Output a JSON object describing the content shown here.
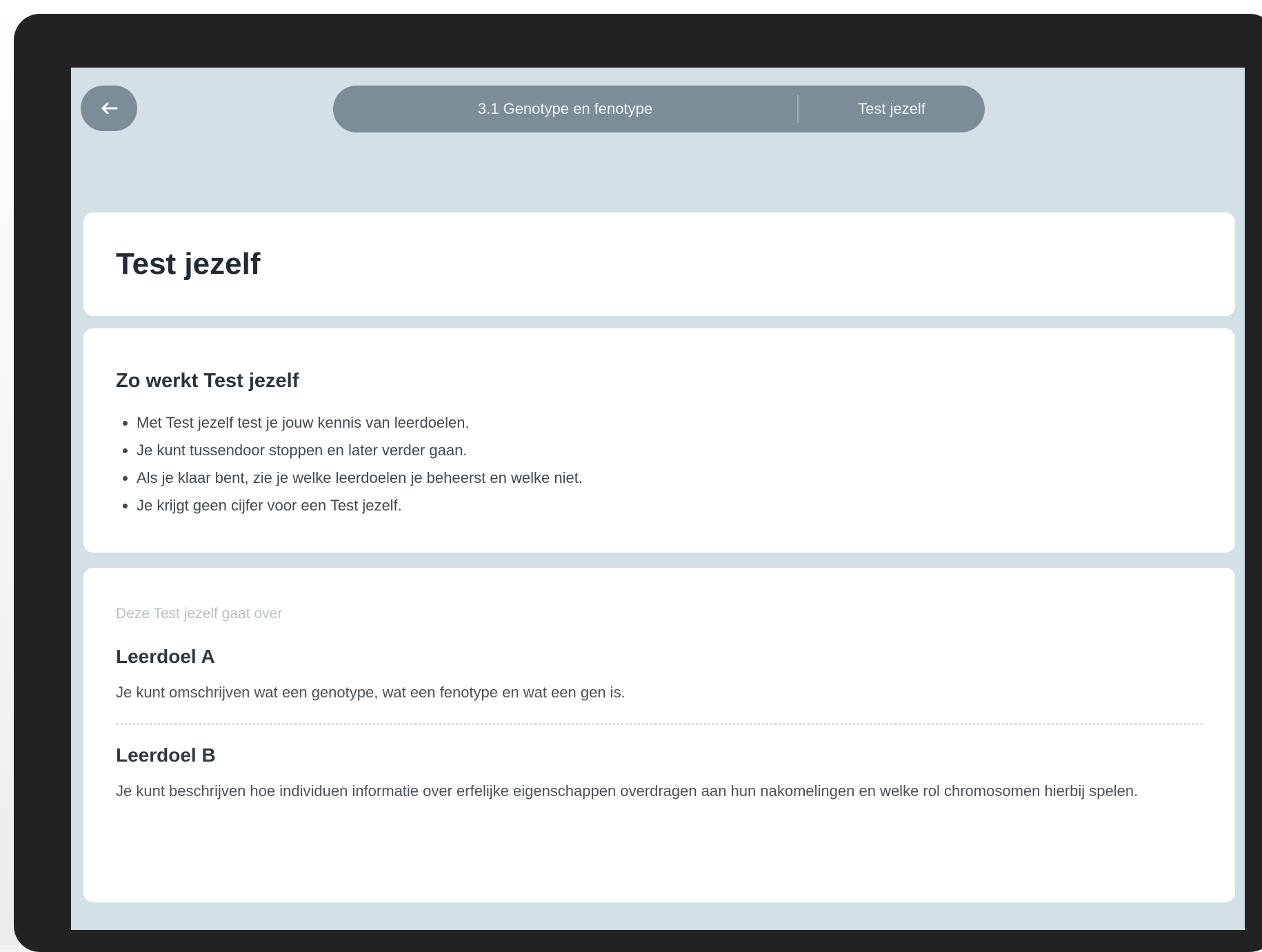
{
  "header": {
    "back_icon": "arrow-left-icon",
    "breadcrumb": [
      "3.1 Genotype en fenotype",
      "Test jezelf"
    ]
  },
  "title_card": {
    "title": "Test jezelf"
  },
  "info_card": {
    "heading": "Zo werkt Test jezelf",
    "items": [
      "Met Test jezelf test je jouw kennis van leerdoelen.",
      "Je kunt tussendoor stoppen en later verder gaan.",
      "Als je klaar bent, zie je welke leerdoelen je beheerst en welke niet.",
      "Je krijgt geen cijfer voor een Test jezelf."
    ]
  },
  "goals_card": {
    "intro": "Deze Test jezelf gaat over",
    "goals": [
      {
        "heading": "Leerdoel A",
        "text": "Je kunt omschrijven wat een genotype, wat een fenotype en wat een gen is."
      },
      {
        "heading": "Leerdoel B",
        "text": "Je kunt beschrijven hoe individuen informatie over erfelijke eigenschappen overdragen aan hun nakomelingen en welke rol chromosomen hierbij spelen."
      }
    ]
  }
}
